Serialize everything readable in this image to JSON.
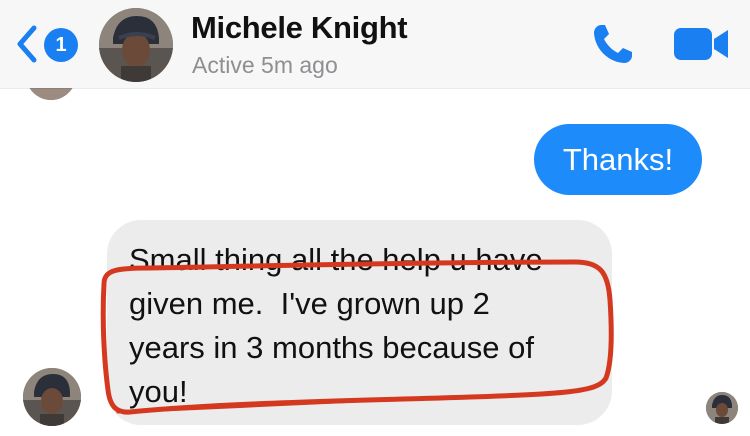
{
  "header": {
    "back_badge": "1",
    "contact_name": "Michele Knight",
    "status": "Active 5m ago",
    "accent_color": "#1a7ff0",
    "icons": [
      "chevron-left-icon",
      "phone-icon",
      "video-camera-icon"
    ]
  },
  "messages": [
    {
      "direction": "outgoing",
      "text": "Thanks!",
      "bubble_color": "#1d8bfa"
    },
    {
      "direction": "incoming",
      "lines": [
        "Small thing all the help u have",
        "given me.  I've grown up 2",
        "years in 3 months because of",
        "you!"
      ],
      "bubble_color": "#ececec"
    }
  ],
  "annotation": {
    "shape": "hand-drawn red outline around message",
    "color": "#d4391f"
  }
}
